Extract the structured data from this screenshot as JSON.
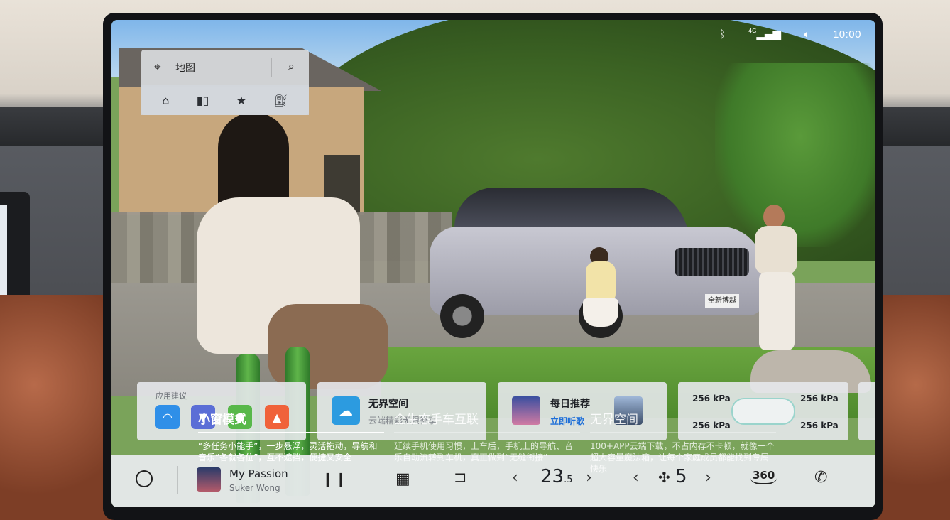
{
  "status_bar": {
    "bluetooth_icon": "bluetooth-icon",
    "signal_label": "4G",
    "volume_icon": "volume-icon",
    "time": "10:00"
  },
  "map_widget": {
    "title": "地图",
    "quick_actions": [
      "home-icon",
      "company-icon",
      "favorites-icon",
      "gas-station-icon"
    ]
  },
  "wallpaper": {
    "car_plate": "全新博越"
  },
  "cards": {
    "app_suggest": {
      "label": "应用建议",
      "apps": [
        "shopping-bag-app",
        "tshirt-app",
        "map-app",
        "photos-app"
      ]
    },
    "cloud_space": {
      "title": "无界空间",
      "subtitle": "云端精彩无限畅享"
    },
    "daily_music": {
      "title": "每日推荐",
      "link": "立即听歌"
    },
    "tire_pressure": {
      "front_left": "256 kPa",
      "front_right": "256 kPa",
      "rear_left": "256 kPa",
      "rear_right": "256 kPa"
    }
  },
  "captions": [
    {
      "title": "小窗模式",
      "desc": "“多任务小能手”，一步悬浮，灵活拖动，导航和音乐“各就各位”，互不遮挡，便捷又安全"
    },
    {
      "title": "全生态手车互联",
      "desc": "延续手机使用习惯，上车后，手机上的导航、音乐自动流转到车机，真正做到“无缝衔接”"
    },
    {
      "title": "无界空间",
      "desc": "100+APP云端下载，不占内存不卡顿，就像一个超大容量魔法箱，让每个家庭成员都能找到专属快乐"
    }
  ],
  "dock": {
    "song": "My Passion",
    "artist": "Suker Wong",
    "temperature_main": "23",
    "temperature_decimal": ".5",
    "fan_level": "5",
    "view_360": "360"
  }
}
